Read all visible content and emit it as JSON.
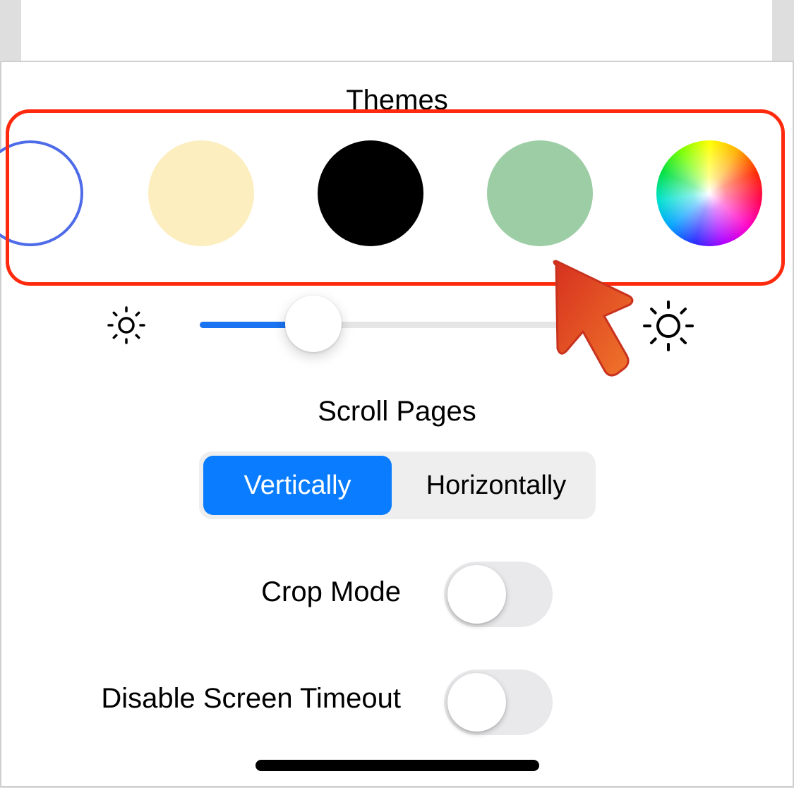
{
  "themes": {
    "title": "Themes",
    "swatches": [
      {
        "name": "white",
        "color": "#ffffff",
        "selected": true,
        "ring_color": "#4e6be8"
      },
      {
        "name": "sepia",
        "color": "#fdeec0"
      },
      {
        "name": "black",
        "color": "#000000"
      },
      {
        "name": "green",
        "color": "#9ccda4"
      },
      {
        "name": "custom",
        "icon": "color-wheel-icon"
      }
    ],
    "highlight_color": "#ff2a0d"
  },
  "brightness": {
    "min_icon": "sun-small-icon",
    "max_icon": "sun-large-icon",
    "value": 0.31,
    "accent": "#1a73f0"
  },
  "scroll_pages": {
    "title": "Scroll Pages",
    "options": [
      "Vertically",
      "Horizontally"
    ],
    "selected": "Vertically",
    "accent": "#0a7cff"
  },
  "settings": {
    "crop_mode": {
      "label": "Crop Mode",
      "enabled": false
    },
    "screen_timeout": {
      "label": "Disable Screen Timeout",
      "enabled": false
    }
  },
  "pointer": {
    "icon": "cursor-arrow-icon",
    "color": "#e8452a"
  }
}
